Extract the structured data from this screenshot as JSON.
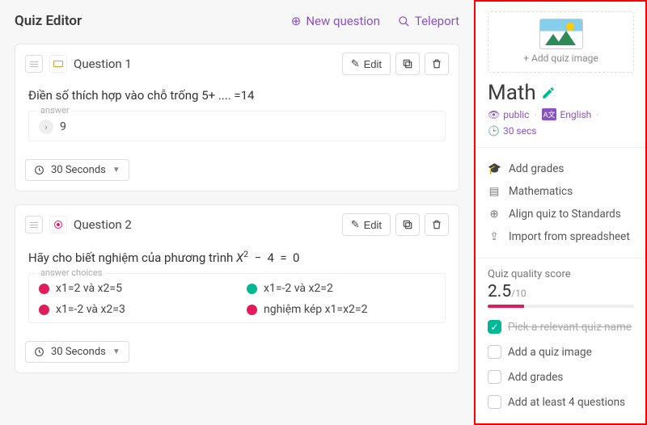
{
  "header": {
    "title": "Quiz Editor",
    "new_question": "New question",
    "teleport": "Teleport"
  },
  "questions": [
    {
      "type": "open",
      "title": "Question 1",
      "text": "Điền số thích hợp vào chỗ trống 5+ .... =14",
      "answer_label": "answer",
      "answer_value": "9",
      "time": "30 Seconds",
      "edit": "Edit"
    },
    {
      "type": "mc",
      "title": "Question 2",
      "text_prefix": "Hãy cho biết nghiệm của phương trình ",
      "math": "X² − 4 = 0",
      "choices_label": "answer choices",
      "choices": [
        {
          "color": "pink",
          "label": "x1=2 và x2=5"
        },
        {
          "color": "green",
          "label": "x1=-2 và x2=2"
        },
        {
          "color": "pink",
          "label": "x1=-2 và x2=3"
        },
        {
          "color": "pink",
          "label": "nghiệm kép x1=x2=2"
        }
      ],
      "time": "30 Seconds",
      "edit": "Edit"
    }
  ],
  "sidebar": {
    "image_drop": "Add quiz image",
    "subject": "Math",
    "meta": {
      "visibility": "public",
      "language": "English",
      "time": "30 secs"
    },
    "links": {
      "grades": "Add grades",
      "subject": "Mathematics",
      "align": "Align quiz to Standards",
      "import": "Import from spreadsheet"
    },
    "quality": {
      "label": "Quiz quality score",
      "score": "2.5",
      "out_of": "/10",
      "items": [
        {
          "done": true,
          "label": "Pick a relevant quiz name"
        },
        {
          "done": false,
          "label": "Add a quiz image"
        },
        {
          "done": false,
          "label": "Add grades"
        },
        {
          "done": false,
          "label": "Add at least 4 questions"
        }
      ]
    }
  }
}
